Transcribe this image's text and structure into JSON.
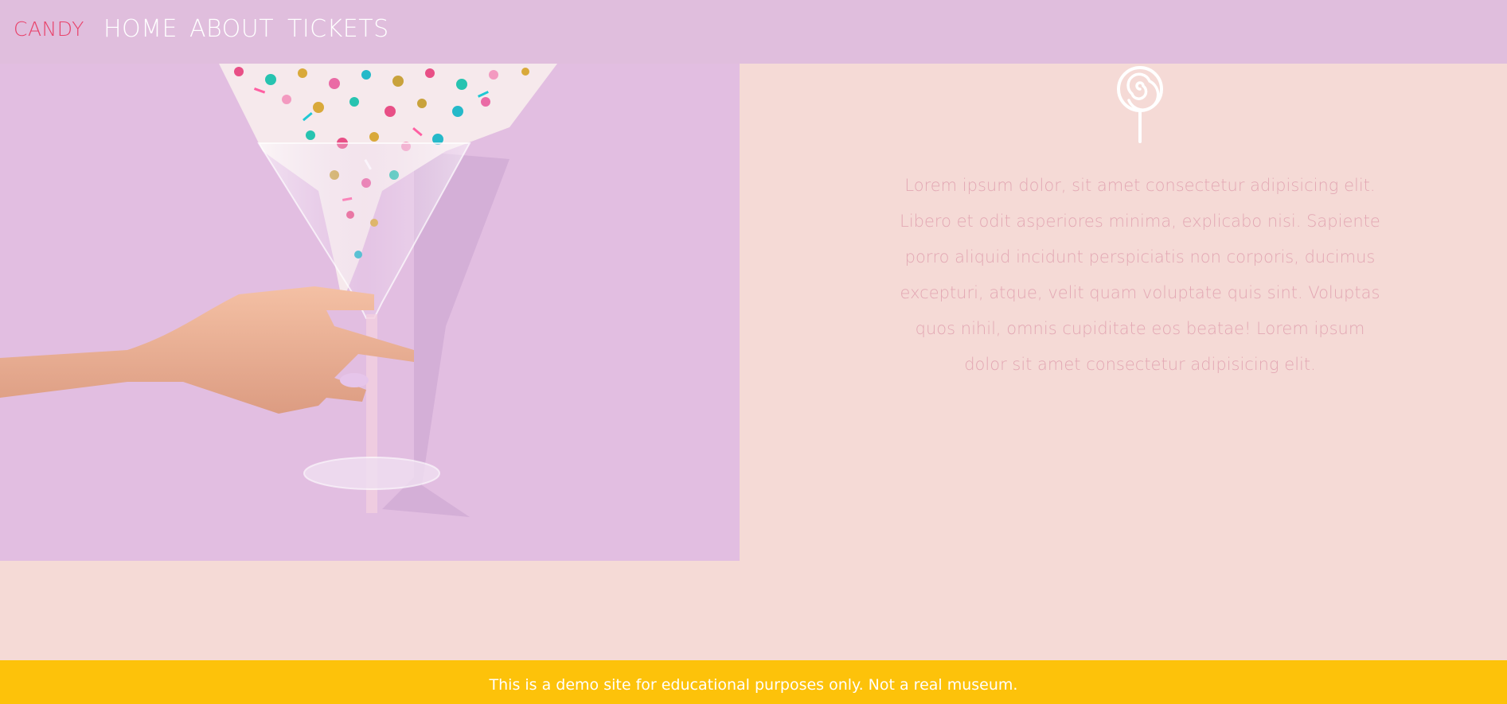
{
  "nav": {
    "brand": "CANDY",
    "links": [
      "HOME",
      "ABOUT",
      "TICKETS"
    ]
  },
  "hero": {
    "image_description_icon": "martini-glass-sprinkles-image",
    "icon": "lollipop-icon",
    "text": "Lorem ipsum dolor, sit amet consectetur adipisicing elit. Libero et odit asperiores minima, explicabo nisi. Sapiente porro aliquid incidunt perspiciatis non corporis, ducimus excepturi, atque, velit quam voluptate quis sint. Voluptas quos nihil, omnis cupiditate eos beatae! Lorem ipsum dolor sit amet consectetur adipisicing elit."
  },
  "footer": {
    "text": "This is a demo site for educational purposes only. Not a real museum."
  },
  "colors": {
    "nav_bg": "#e0bedd",
    "brand": "#e8436b",
    "page_bg": "#f5dad6",
    "text": "#e3a8b4",
    "footer_bg": "#fdc20a"
  }
}
